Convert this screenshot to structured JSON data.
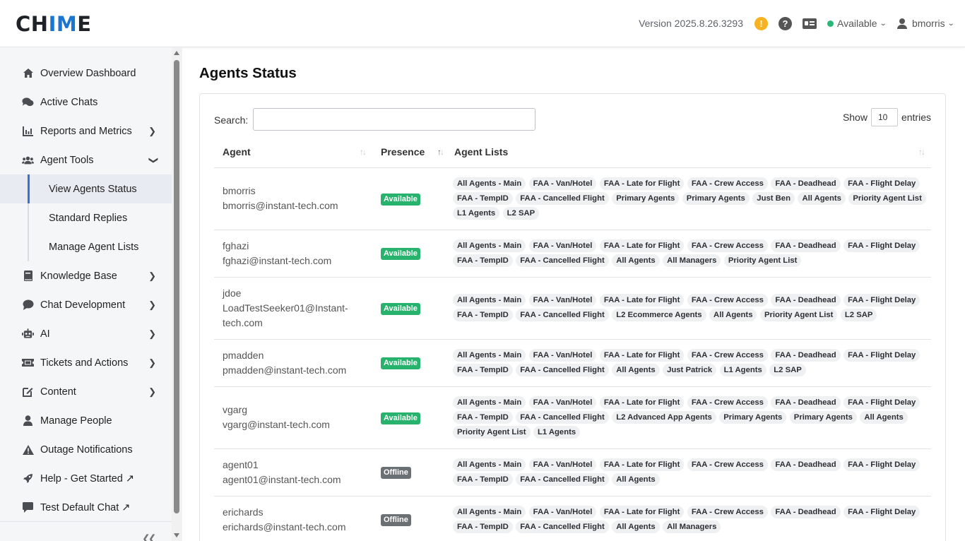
{
  "header": {
    "logo_main": "CH",
    "logo_accent": "IM",
    "logo_tail": "E",
    "version": "Version 2025.8.26.3293",
    "presence": "Available",
    "username": "bmorris"
  },
  "sidebar": {
    "items": [
      {
        "label": "Overview Dashboard",
        "icon": "home-icon"
      },
      {
        "label": "Active Chats",
        "icon": "chats-icon"
      },
      {
        "label": "Reports and Metrics",
        "icon": "chart-icon"
      },
      {
        "label": "Agent Tools",
        "icon": "users-icon"
      },
      {
        "label": "Knowledge Base",
        "icon": "book-icon"
      },
      {
        "label": "Chat Development",
        "icon": "chat-bubble-icon"
      },
      {
        "label": "AI",
        "icon": "robot-icon"
      },
      {
        "label": "Tickets and Actions",
        "icon": "ticket-icon"
      },
      {
        "label": "Content",
        "icon": "edit-icon"
      },
      {
        "label": "Manage People",
        "icon": "person-icon"
      },
      {
        "label": "Outage Notifications",
        "icon": "warning-icon"
      },
      {
        "label": "Help - Get Started ↗",
        "icon": "rocket-icon"
      },
      {
        "label": "Test Default Chat ↗",
        "icon": "message-icon"
      }
    ],
    "sub_items": [
      {
        "label": "View Agents Status",
        "active": true
      },
      {
        "label": "Standard Replies"
      },
      {
        "label": "Manage Agent Lists"
      }
    ]
  },
  "main": {
    "title": "Agents Status",
    "search_label": "Search:",
    "show_label": "Show",
    "entries_value": "10",
    "entries_label": "entries",
    "columns": [
      "Agent",
      "Presence",
      "Agent Lists"
    ],
    "rows": [
      {
        "name": "bmorris",
        "email": "bmorris@instant-tech.com",
        "presence": "Available",
        "lists": [
          "All Agents - Main",
          "FAA - Van/Hotel",
          "FAA - Late for Flight",
          "FAA - Crew Access",
          "FAA - Deadhead",
          "FAA - Flight Delay",
          "FAA - TempID",
          "FAA - Cancelled Flight",
          "Primary Agents",
          "Primary Agents",
          "Just Ben",
          "All Agents",
          "Priority Agent List",
          "L1 Agents",
          "L2 SAP"
        ]
      },
      {
        "name": "fghazi",
        "email": "fghazi@instant-tech.com",
        "presence": "Available",
        "lists": [
          "All Agents - Main",
          "FAA - Van/Hotel",
          "FAA - Late for Flight",
          "FAA - Crew Access",
          "FAA - Deadhead",
          "FAA - Flight Delay",
          "FAA - TempID",
          "FAA - Cancelled Flight",
          "All Agents",
          "All Managers",
          "Priority Agent List"
        ]
      },
      {
        "name": "jdoe",
        "email": "LoadTestSeeker01@Instant-tech.com",
        "presence": "Available",
        "lists": [
          "All Agents - Main",
          "FAA - Van/Hotel",
          "FAA - Late for Flight",
          "FAA - Crew Access",
          "FAA - Deadhead",
          "FAA - Flight Delay",
          "FAA - TempID",
          "FAA - Cancelled Flight",
          "L2 Ecommerce Agents",
          "All Agents",
          "Priority Agent List",
          "L2 SAP"
        ]
      },
      {
        "name": "pmadden",
        "email": "pmadden@instant-tech.com",
        "presence": "Available",
        "lists": [
          "All Agents - Main",
          "FAA - Van/Hotel",
          "FAA - Late for Flight",
          "FAA - Crew Access",
          "FAA - Deadhead",
          "FAA - Flight Delay",
          "FAA - TempID",
          "FAA - Cancelled Flight",
          "All Agents",
          "Just Patrick",
          "L1 Agents",
          "L2 SAP"
        ]
      },
      {
        "name": "vgarg",
        "email": "vgarg@instant-tech.com",
        "presence": "Available",
        "lists": [
          "All Agents - Main",
          "FAA - Van/Hotel",
          "FAA - Late for Flight",
          "FAA - Crew Access",
          "FAA - Deadhead",
          "FAA - Flight Delay",
          "FAA - TempID",
          "FAA - Cancelled Flight",
          "L2 Advanced App Agents",
          "Primary Agents",
          "Primary Agents",
          "All Agents",
          "Priority Agent List",
          "L1 Agents"
        ]
      },
      {
        "name": "agent01",
        "email": "agent01@instant-tech.com",
        "presence": "Offline",
        "lists": [
          "All Agents - Main",
          "FAA - Van/Hotel",
          "FAA - Late for Flight",
          "FAA - Crew Access",
          "FAA - Deadhead",
          "FAA - Flight Delay",
          "FAA - TempID",
          "FAA - Cancelled Flight",
          "All Agents"
        ]
      },
      {
        "name": "erichards",
        "email": "erichards@instant-tech.com",
        "presence": "Offline",
        "lists": [
          "All Agents - Main",
          "FAA - Van/Hotel",
          "FAA - Late for Flight",
          "FAA - Crew Access",
          "FAA - Deadhead",
          "FAA - Flight Delay",
          "FAA - TempID",
          "FAA - Cancelled Flight",
          "All Agents",
          "All Managers"
        ]
      }
    ]
  },
  "colors": {
    "available": "#27b36d",
    "offline": "#6b7075",
    "accent": "#1b76d1",
    "active_nav_bar": "#3a6fd8"
  }
}
